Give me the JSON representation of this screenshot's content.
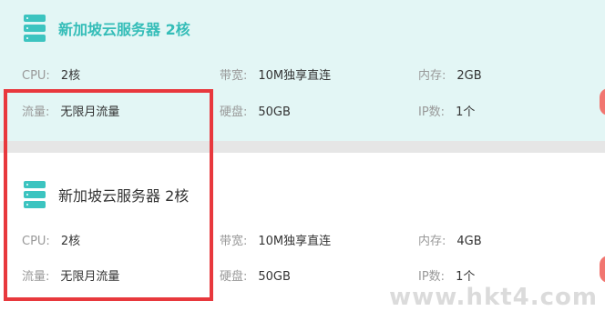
{
  "plans": [
    {
      "title": "新加坡云服务器 2核",
      "specs": {
        "cpu": {
          "key": "CPU:",
          "value": "2核"
        },
        "bandwidth": {
          "key": "带宽:",
          "value": "10M独享直连"
        },
        "memory": {
          "key": "内存:",
          "value": "2GB"
        },
        "traffic": {
          "key": "流量:",
          "value": "无限月流量"
        },
        "disk": {
          "key": "硬盘:",
          "value": "50GB"
        },
        "ip": {
          "key": "IP数:",
          "value": "1个"
        }
      }
    },
    {
      "title": "新加坡云服务器 2核",
      "specs": {
        "cpu": {
          "key": "CPU:",
          "value": "2核"
        },
        "bandwidth": {
          "key": "带宽:",
          "value": "10M独享直连"
        },
        "memory": {
          "key": "内存:",
          "value": "4GB"
        },
        "traffic": {
          "key": "流量:",
          "value": "无限月流量"
        },
        "disk": {
          "key": "硬盘:",
          "value": "50GB"
        },
        "ip": {
          "key": "IP数:",
          "value": "1个"
        }
      }
    }
  ],
  "watermark": "www.hkt4.com",
  "colors": {
    "accent": "#34bdb8",
    "highlight_bg": "#e3f6f5",
    "highlight_border": "#e8383d",
    "side_button": "#f17670"
  }
}
